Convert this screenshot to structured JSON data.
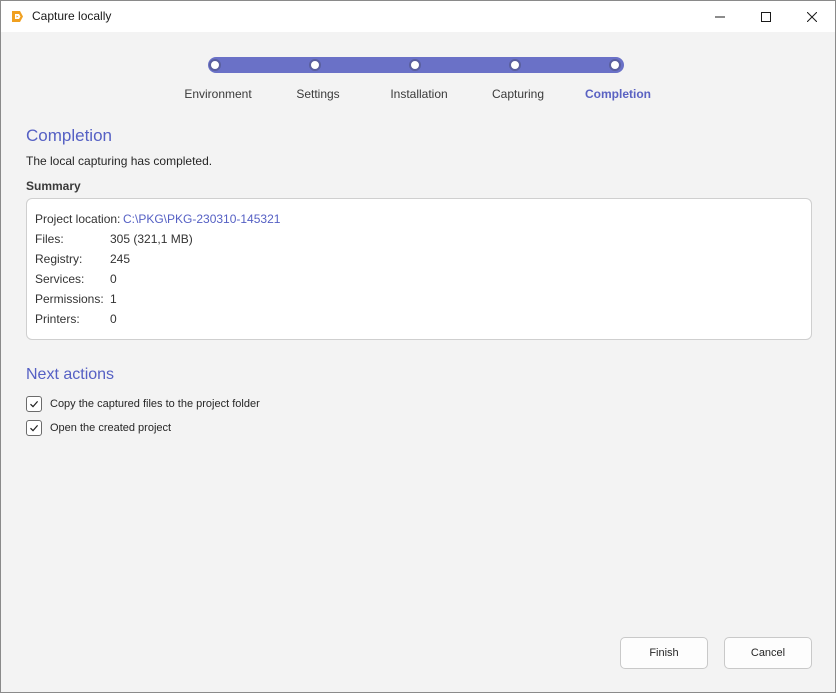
{
  "window": {
    "title": "Capture locally",
    "icon": "app-logo-icon",
    "controls": [
      "minimize-icon",
      "maximize-icon",
      "close-icon"
    ]
  },
  "stepper": {
    "steps": [
      {
        "label": "Environment",
        "active": false
      },
      {
        "label": "Settings",
        "active": false
      },
      {
        "label": "Installation",
        "active": false
      },
      {
        "label": "Capturing",
        "active": false
      },
      {
        "label": "Completion",
        "active": true
      }
    ],
    "track_color": "#6a71c7"
  },
  "page": {
    "title": "Completion",
    "description": "The local capturing has completed.",
    "summary_label": "Summary"
  },
  "summary": {
    "project_location_label": "Project location:",
    "project_location_value": "C:\\PKG\\PKG-230310-145321",
    "rows": [
      {
        "key": "Files:",
        "value": "305 (321,1 MB)"
      },
      {
        "key": "Registry:",
        "value": "245"
      },
      {
        "key": "Services:",
        "value": "0"
      },
      {
        "key": "Permissions:",
        "value": "1"
      },
      {
        "key": "Printers:",
        "value": "0"
      }
    ]
  },
  "next_actions": {
    "title": "Next actions",
    "options": [
      {
        "label": "Copy the captured files to the project folder",
        "checked": true
      },
      {
        "label": "Open the created project",
        "checked": true
      }
    ]
  },
  "buttons": {
    "finish": "Finish",
    "cancel": "Cancel"
  },
  "colors": {
    "accent": "#5560c4",
    "background": "#f3f3f3"
  }
}
